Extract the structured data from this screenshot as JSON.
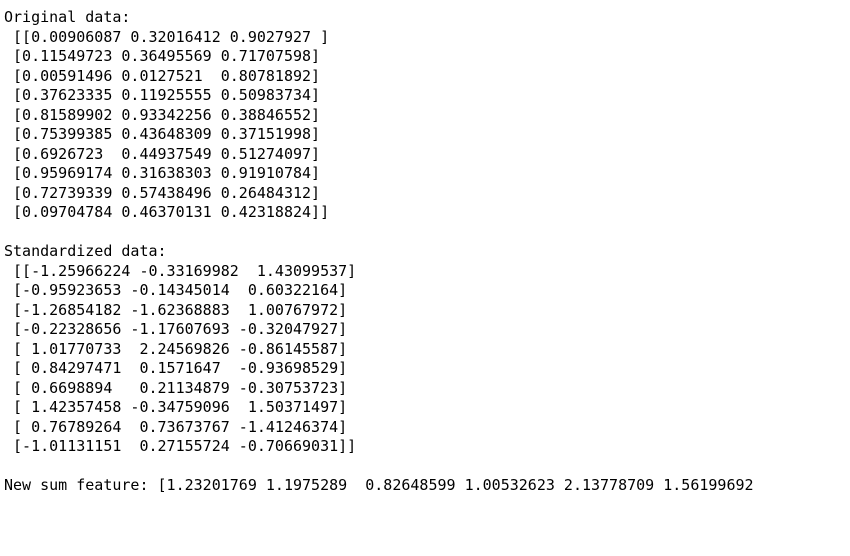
{
  "headings": {
    "original": "Original data:",
    "standardized": "Standardized data:",
    "newsum": "New sum feature:"
  },
  "original": [
    [
      0.00906087,
      0.32016412,
      0.9027927
    ],
    [
      0.11549723,
      0.36495569,
      0.71707598
    ],
    [
      0.00591496,
      0.0127521,
      0.80781892
    ],
    [
      0.37623335,
      0.11925555,
      0.50983734
    ],
    [
      0.81589902,
      0.93342256,
      0.38846552
    ],
    [
      0.75399385,
      0.43648309,
      0.37151998
    ],
    [
      0.6926723,
      0.44937549,
      0.51274097
    ],
    [
      0.95969174,
      0.31638303,
      0.91910784
    ],
    [
      0.72739339,
      0.57438496,
      0.26484312
    ],
    [
      0.09704784,
      0.46370131,
      0.42318824
    ]
  ],
  "standardized": [
    [
      -1.25966224,
      -0.33169982,
      1.43099537
    ],
    [
      -0.95923653,
      -0.14345014,
      0.60322164
    ],
    [
      -1.26854182,
      -1.62368883,
      1.00767972
    ],
    [
      -0.22328656,
      -1.17607693,
      -0.32047927
    ],
    [
      1.01770733,
      2.24569826,
      -0.86145587
    ],
    [
      0.84297471,
      0.1571647,
      -0.93698529
    ],
    [
      0.6698894,
      0.21134879,
      -0.30753723
    ],
    [
      1.42357458,
      -0.34759096,
      1.50371497
    ],
    [
      0.76789264,
      0.73673767,
      -1.41246374
    ],
    [
      -1.01131151,
      0.27155724,
      -0.70669031
    ]
  ],
  "new_sum_feature": [
    1.23201769,
    1.1975289,
    0.82648599,
    1.00532623,
    2.13778709,
    1.56199692
  ],
  "formatted_lines": {
    "orig": [
      " [[0.00906087 0.32016412 0.9027927 ]",
      " [0.11549723 0.36495569 0.71707598]",
      " [0.00591496 0.0127521  0.80781892]",
      " [0.37623335 0.11925555 0.50983734]",
      " [0.81589902 0.93342256 0.38846552]",
      " [0.75399385 0.43648309 0.37151998]",
      " [0.6926723  0.44937549 0.51274097]",
      " [0.95969174 0.31638303 0.91910784]",
      " [0.72739339 0.57438496 0.26484312]",
      " [0.09704784 0.46370131 0.42318824]]"
    ],
    "std": [
      " [[-1.25966224 -0.33169982  1.43099537]",
      " [-0.95923653 -0.14345014  0.60322164]",
      " [-1.26854182 -1.62368883  1.00767972]",
      " [-0.22328656 -1.17607693 -0.32047927]",
      " [ 1.01770733  2.24569826 -0.86145587]",
      " [ 0.84297471  0.1571647  -0.93698529]",
      " [ 0.6698894   0.21134879 -0.30753723]",
      " [ 1.42357458 -0.34759096  1.50371497]",
      " [ 0.76789264  0.73673767 -1.41246374]",
      " [-1.01131151  0.27155724 -0.70669031]]"
    ],
    "newsum_row": "New sum feature: [1.23201769 1.1975289  0.82648599 1.00532623 2.13778709 1.56199692"
  }
}
